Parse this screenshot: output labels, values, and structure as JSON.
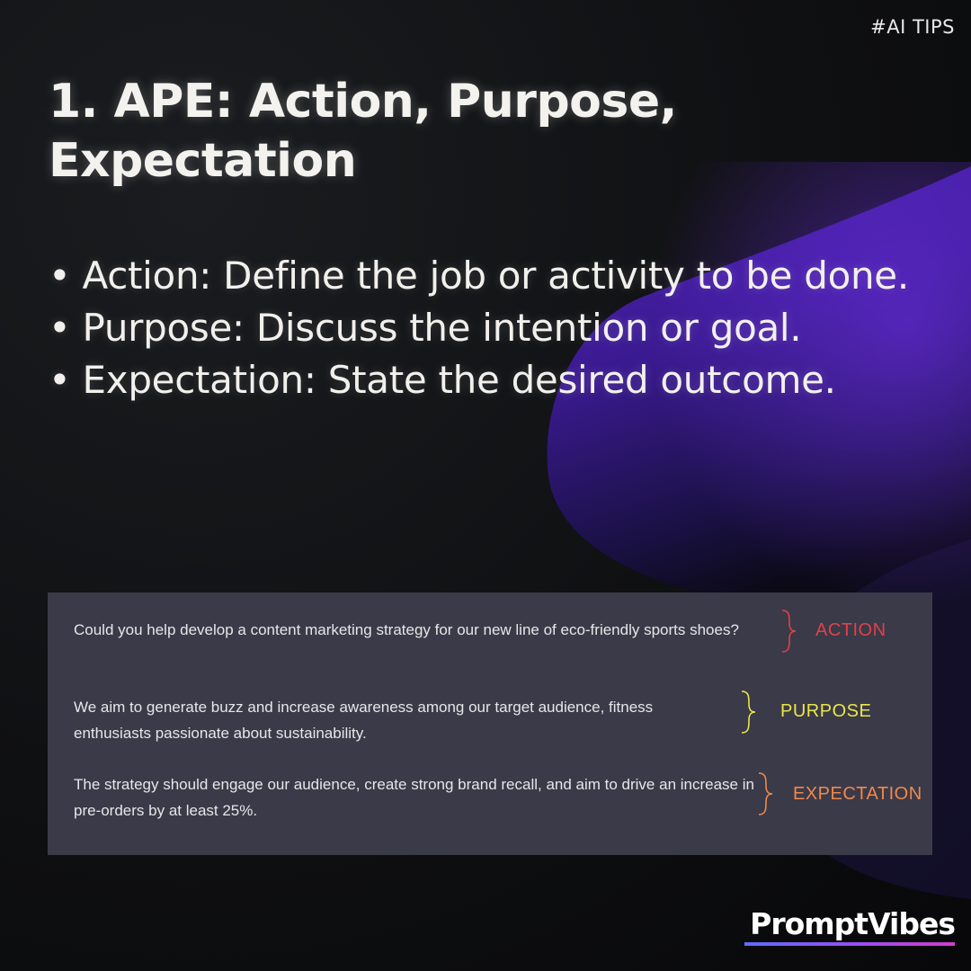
{
  "tag": "#AI TIPS",
  "title": "1. APE: Action, Purpose, Expectation",
  "points": [
    "• Action: Define the job or activity to be done.",
    "• Purpose: Discuss the intention or goal.",
    "• Expectation: State the desired outcome."
  ],
  "example": {
    "action_text": "Could you help develop a content marketing strategy for our new line of eco-friendly sports shoes?",
    "action_label": "ACTION",
    "purpose_text": "We aim to generate buzz and increase awareness among our target audience, fitness enthusiasts passionate about sustainability.",
    "purpose_label": "PURPOSE",
    "expectation_text": "The strategy should engage our audience, create strong brand recall, and aim to drive an increase in pre-orders by at least 25%.",
    "expectation_label": "EXPECTATION"
  },
  "brand": "PromptVibes",
  "colors": {
    "background": "#0f1012",
    "card": "#3b3a48",
    "action": "#e0414a",
    "purpose": "#e9e64a",
    "expectation": "#f0894d",
    "accent_purple": "#4d1fb0"
  }
}
